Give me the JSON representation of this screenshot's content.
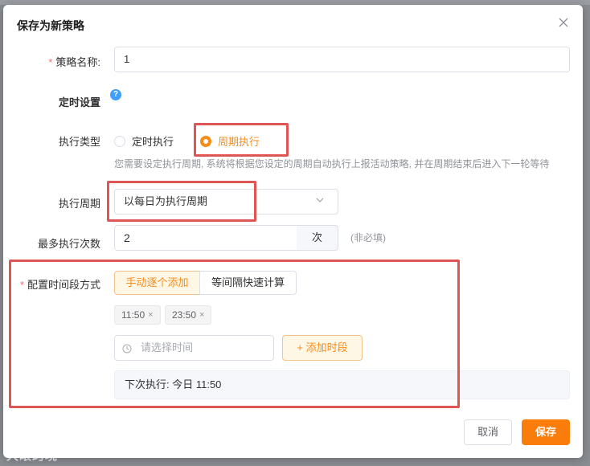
{
  "dialog": {
    "title": "保存为新策略"
  },
  "form": {
    "strategy_name": {
      "required_mark": "*",
      "label": "策略名称:",
      "value": "1"
    },
    "schedule_section": {
      "label": "定时设置",
      "help_glyph": "?"
    },
    "exec_type": {
      "label": "执行类型",
      "options": [
        {
          "label": "定时执行",
          "checked": false
        },
        {
          "label": "周期执行",
          "checked": true
        }
      ],
      "hint": "您需要设定执行周期, 系统将根据您设定的周期自动执行上报活动策略, 并在周期结束后进入下一轮等待"
    },
    "exec_period": {
      "label": "执行周期",
      "value": "以每日为执行周期"
    },
    "max_exec_count": {
      "label": "最多执行次数",
      "value": "2",
      "suffix": "次",
      "optional_note": "(非必填)"
    },
    "time_slot_mode": {
      "required_mark": "*",
      "label": "配置时间段方式",
      "segments": [
        {
          "label": "手动逐个添加",
          "active": true
        },
        {
          "label": "等间隔快速计算",
          "active": false
        }
      ],
      "tags": [
        {
          "label": "11:50",
          "close": "×"
        },
        {
          "label": "23:50",
          "close": "×"
        }
      ],
      "time_placeholder": "请选择时间",
      "add_button": "+ 添加时段",
      "next_exec": "下次执行: 今日 11:50"
    }
  },
  "footer": {
    "cancel": "取消",
    "save": "保存"
  },
  "watermark": "大眼跨境",
  "colors": {
    "accent": "#fa8c16",
    "annotation_red": "#e15454",
    "required": "#f56c6c"
  }
}
